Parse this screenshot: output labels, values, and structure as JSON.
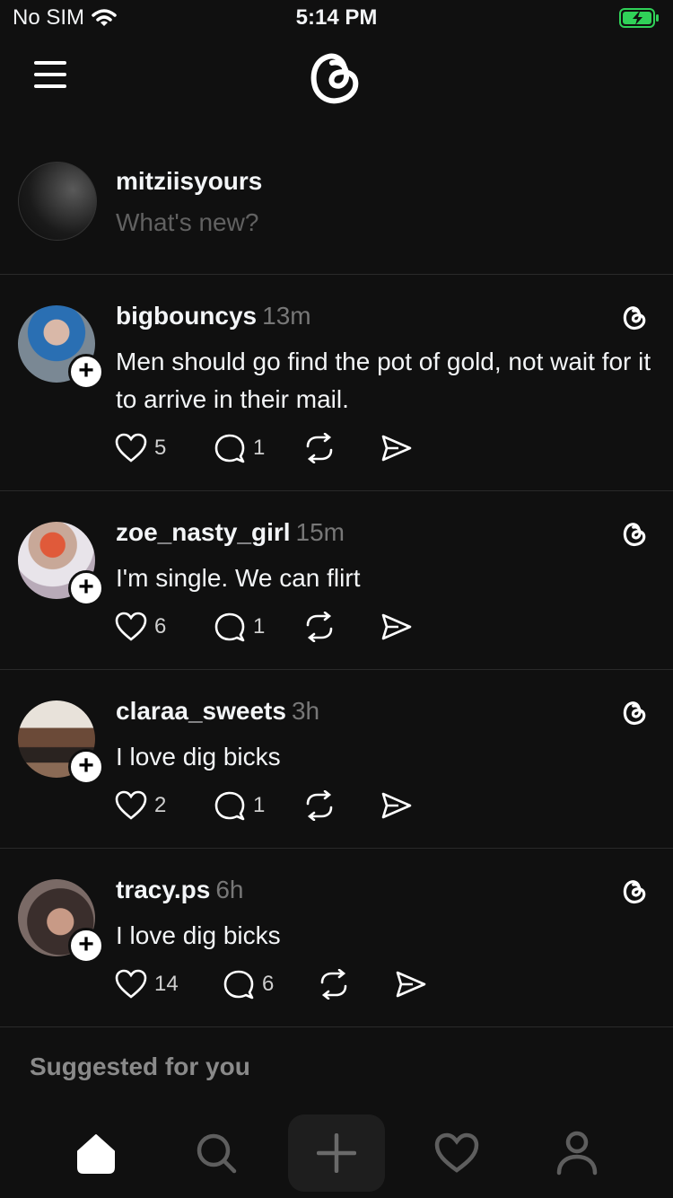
{
  "status_bar": {
    "carrier": "No SIM",
    "time": "5:14 PM",
    "battery_color": "#30d158"
  },
  "composer": {
    "username": "mitziisyours",
    "placeholder": "What's new?"
  },
  "posts": [
    {
      "username": "bigbouncys",
      "time": "13m",
      "text": "Men should go find the pot of gold, not wait for it to arrive in their mail.",
      "likes": "5",
      "replies": "1"
    },
    {
      "username": "zoe_nasty_girl",
      "time": "15m",
      "text": "I'm single. We can flirt",
      "likes": "6",
      "replies": "1"
    },
    {
      "username": "claraa_sweets",
      "time": "3h",
      "text": "I love dig bicks",
      "likes": "2",
      "replies": "1"
    },
    {
      "username": "tracy.ps",
      "time": "6h",
      "text": "I love dig bicks",
      "likes": "14",
      "replies": "6"
    }
  ],
  "suggested_label": "Suggested for you",
  "tabs": [
    {
      "name": "home",
      "icon": "home-icon"
    },
    {
      "name": "search",
      "icon": "search-icon"
    },
    {
      "name": "create",
      "icon": "plus-icon"
    },
    {
      "name": "activity",
      "icon": "heart-icon"
    },
    {
      "name": "profile",
      "icon": "person-icon"
    }
  ]
}
